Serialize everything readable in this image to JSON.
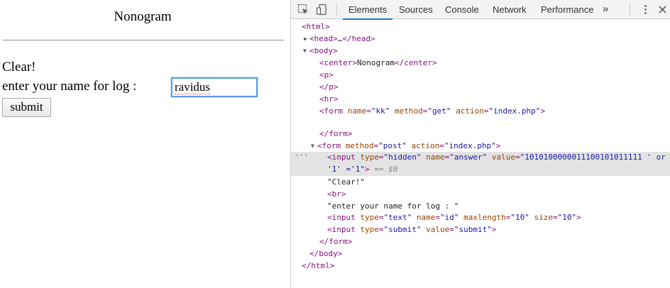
{
  "page": {
    "title": "Nonogram",
    "clear_text": "Clear!",
    "prompt_label": "enter your name for log : ",
    "name_value": "ravidus",
    "submit_label": "submit"
  },
  "devtools": {
    "tabs": [
      "Elements",
      "Sources",
      "Console",
      "Network",
      "Performance"
    ],
    "active_tab": "Elements",
    "accent_color": "#1a73e8",
    "dom": {
      "l1_open": "<html>",
      "l2_head_open": "<head>",
      "l2_head_ellipsis": "…",
      "l2_head_close": "</head>",
      "l3_body": "<body>",
      "l4_center_open": "<center>",
      "l4_center_text": "Nonogram",
      "l4_center_close": "</center>",
      "l5_p_open": "<p>",
      "l6_p_close": "</p>",
      "l7_hr": "<hr>",
      "l8_form_tag": "<form",
      "l8_name_attr": "name",
      "l8_name_val": "\"kk\"",
      "l8_method_attr": "method",
      "l8_method_val": "\"get\"",
      "l8_action_attr": "action",
      "l8_action_val": "\"index.php\"",
      "l8_end": ">",
      "l9_form_close": "</form>",
      "l10_form_tag": "<form",
      "l10_method_attr": "method",
      "l10_method_val": "\"post\"",
      "l10_action_attr": "action",
      "l10_action_val": "\"index.php\"",
      "l10_end": ">",
      "l11_input_tag": "<input",
      "l11_type_attr": "type",
      "l11_type_val": "\"hidden\"",
      "l11_name_attr": "name",
      "l11_name_val": "\"answer\"",
      "l11_value_attr": "value",
      "l11_value_val": "\"1010100000011100101011111 ' or",
      "l12_value_cont": "'1' ='1\"",
      "l12_end": ">",
      "l12_eq": "== $0",
      "l13_text": "\"Clear!\"",
      "l14_br": "<br>",
      "l15_text": "\"enter your name for log : \"",
      "l16_input_tag": "<input",
      "l16_type_attr": "type",
      "l16_type_val": "\"text\"",
      "l16_name_attr": "name",
      "l16_name_val": "\"id\"",
      "l16_maxlength_attr": "maxlength",
      "l16_maxlength_val": "\"10\"",
      "l16_size_attr": "size",
      "l16_size_val": "\"10\"",
      "l16_end": ">",
      "l17_input_tag": "<input",
      "l17_type_attr": "type",
      "l17_type_val": "\"submit\"",
      "l17_value_attr": "value",
      "l17_value_val": "\"submit\"",
      "l17_end": ">",
      "l18_form_close": "</form>",
      "l19_body_close": "</body>",
      "l20_html_close": "</html>"
    }
  }
}
